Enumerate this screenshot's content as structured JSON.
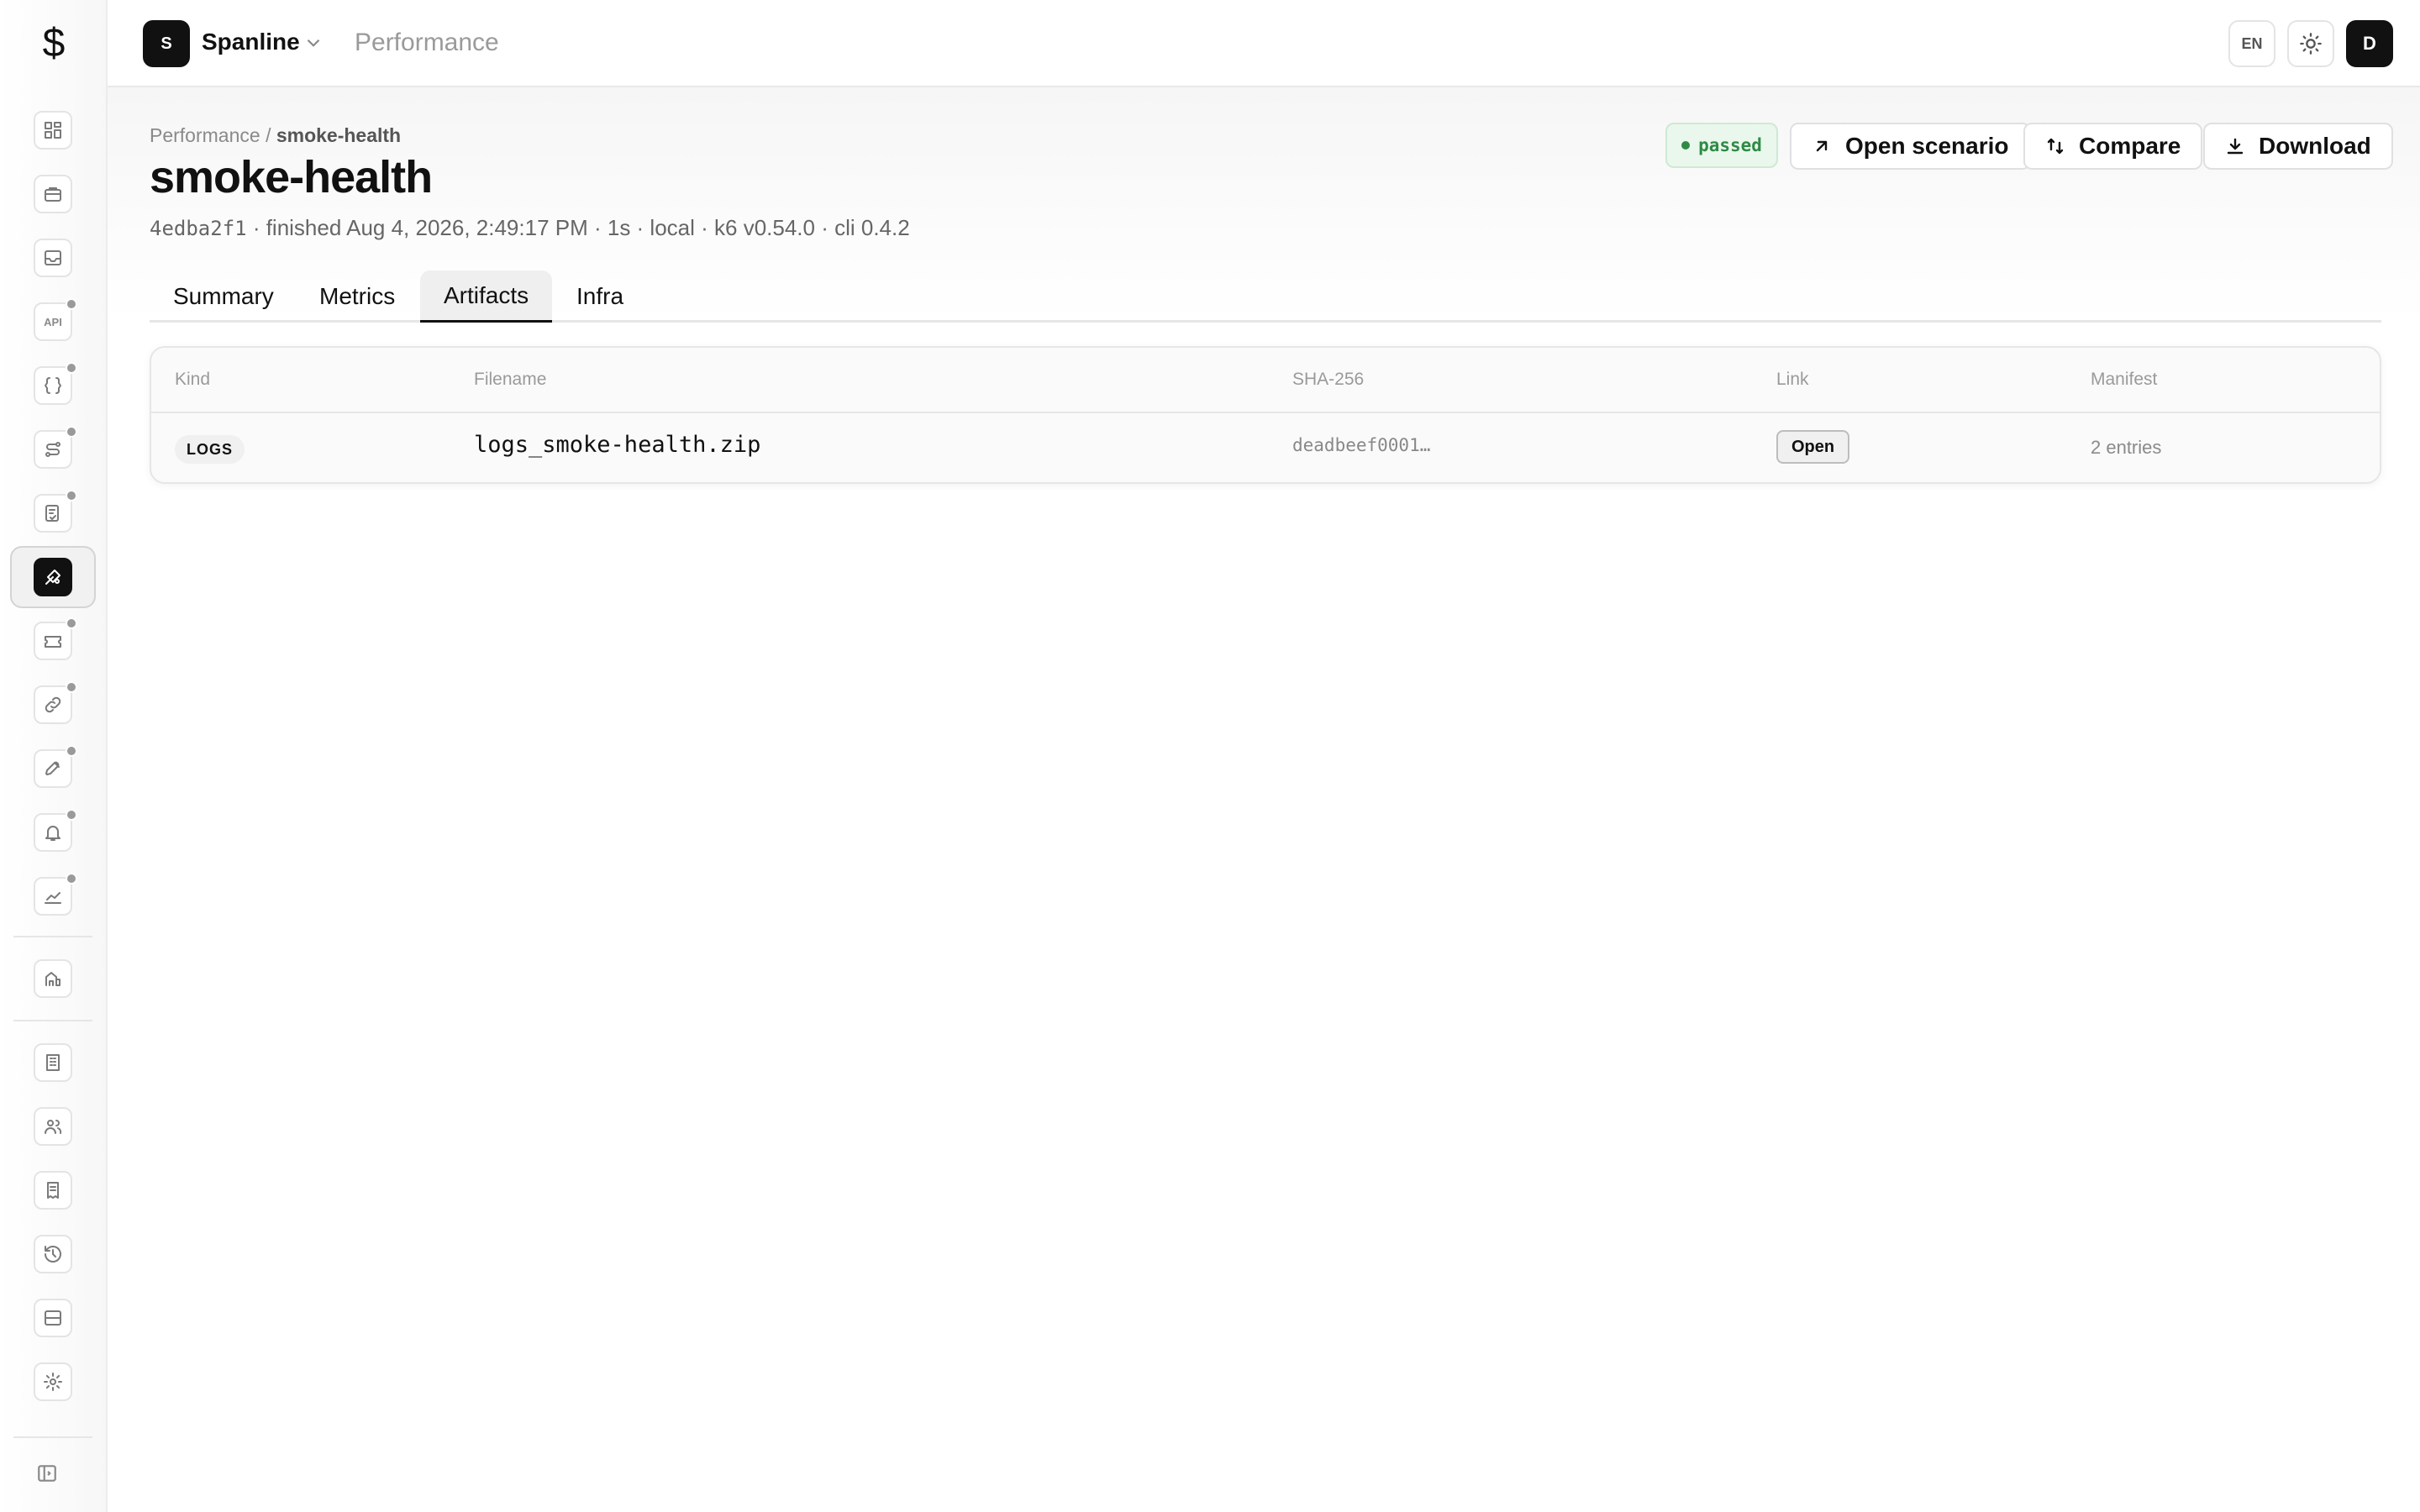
{
  "app": {
    "logo_glyph": "$",
    "org_initial": "S",
    "org_name": "Spanline",
    "page": "Performance",
    "lang": "EN",
    "user_initial": "D"
  },
  "sidebar": {
    "items": [
      {
        "icon": "dashboard-icon",
        "dot": false
      },
      {
        "icon": "briefcase-icon",
        "dot": false
      },
      {
        "icon": "inbox-icon",
        "dot": false
      },
      {
        "icon": "api-icon",
        "label": "API",
        "dot": true
      },
      {
        "icon": "braces-icon",
        "dot": true
      },
      {
        "icon": "route-icon",
        "dot": true
      },
      {
        "icon": "checklist-icon",
        "dot": true
      },
      {
        "icon": "performance-icon",
        "dot": false,
        "active": true
      },
      {
        "icon": "ticket-icon",
        "dot": true
      },
      {
        "icon": "link-icon",
        "dot": true
      },
      {
        "icon": "rocket-icon",
        "dot": true
      },
      {
        "icon": "bell-icon",
        "dot": true
      },
      {
        "icon": "chart-icon",
        "dot": true
      },
      {
        "icon": "building-icon",
        "dot": false
      },
      {
        "icon": "office-icon",
        "dot": false
      },
      {
        "icon": "users-icon",
        "dot": false
      },
      {
        "icon": "receipt-icon",
        "dot": false
      },
      {
        "icon": "history-icon",
        "dot": false
      },
      {
        "icon": "server-icon",
        "dot": false
      },
      {
        "icon": "gear-icon",
        "dot": false
      }
    ]
  },
  "breadcrumb": {
    "parent": "Performance",
    "separator": "/",
    "current": "smoke-health"
  },
  "run": {
    "title": "smoke-health",
    "id": "4edba2f1",
    "meta": " · finished Aug 4, 2026, 2:49:17 PM · 1s · local · k6 v0.54.0 · cli 0.4.2",
    "status": "passed",
    "status_color": "#2f8a45"
  },
  "actions": {
    "open_scenario": "Open scenario",
    "compare": "Compare",
    "download": "Download"
  },
  "tabs": [
    {
      "label": "Summary",
      "active": false
    },
    {
      "label": "Metrics",
      "active": false
    },
    {
      "label": "Artifacts",
      "active": true
    },
    {
      "label": "Infra",
      "active": false
    }
  ],
  "artifacts": {
    "columns": [
      "Kind",
      "Filename",
      "SHA-256",
      "Link",
      "Manifest"
    ],
    "rows": [
      {
        "kind": "LOGS",
        "filename": "logs_smoke-health.zip",
        "sha": "deadbeef0001…",
        "link_label": "Open",
        "manifest": "2 entries"
      }
    ]
  }
}
